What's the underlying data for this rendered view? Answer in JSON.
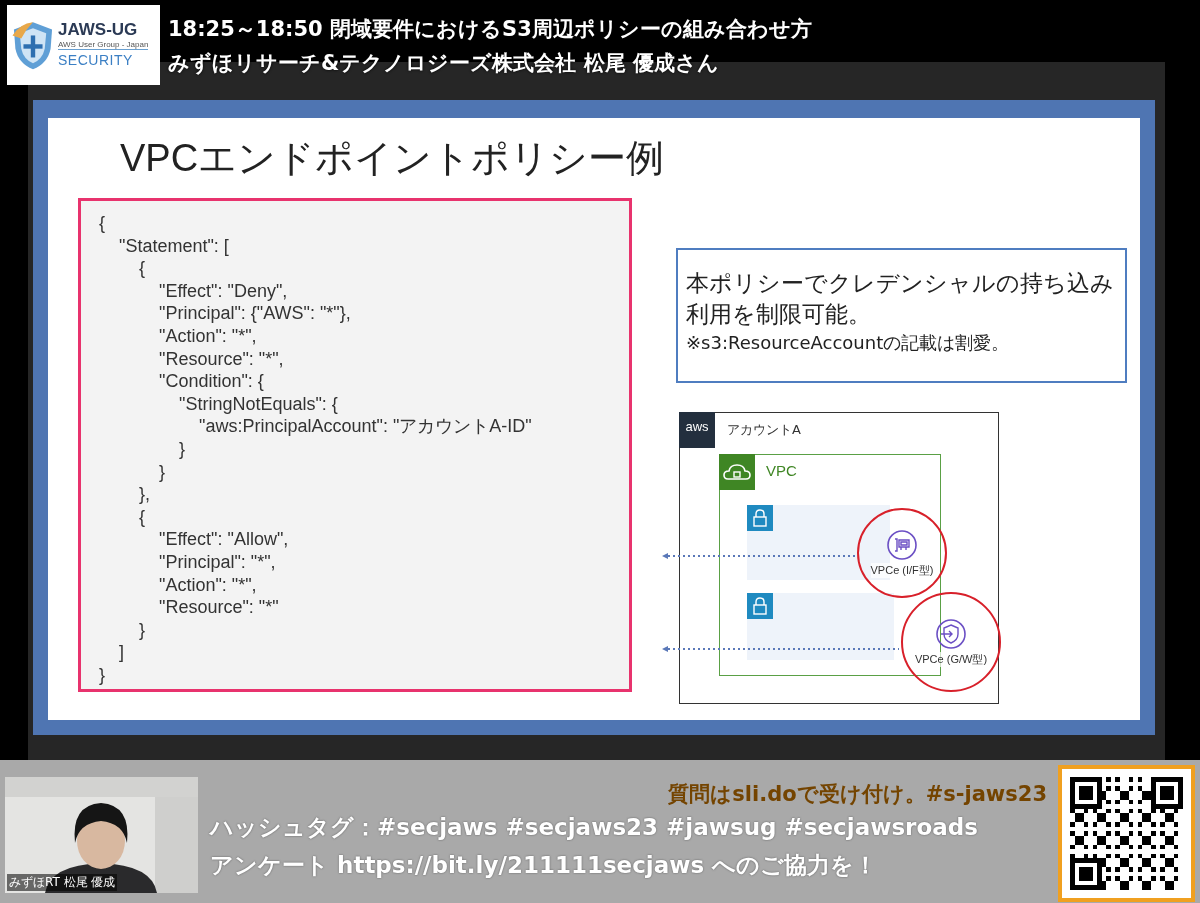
{
  "header": {
    "logo": {
      "title": "JAWS-UG",
      "subtitle": "AWS User Group - Japan",
      "label": "SECURITY"
    },
    "title": "18:25～18:50 閉域要件におけるS3周辺ポリシーの組み合わせ方",
    "speaker": "みずほリサーチ&テクノロジーズ株式会社 松尾 優成さん"
  },
  "slide": {
    "title": "VPCエンドポイントポリシー例",
    "code_lines": [
      "{",
      "    \"Statement\": [",
      "        {",
      "            \"Effect\": \"Deny\",",
      "            \"Principal\": {\"AWS\": \"*\"},",
      "            \"Action\": \"*\",",
      "            \"Resource\": \"*\",",
      "            \"Condition\": {",
      "                \"StringNotEquals\": {",
      "                    \"aws:PrincipalAccount\": \"アカウントA-ID\"",
      "                }",
      "            }",
      "        },",
      "        {",
      "            \"Effect\": \"Allow\",",
      "            \"Principal\": \"*\",",
      "            \"Action\": \"*\",",
      "            \"Resource\": \"*\"",
      "        }",
      "    ]",
      "}"
    ],
    "callout": {
      "lines": [
        "本ポリシーでクレデンシャルの持ち込み",
        "利用を制限可能。"
      ],
      "note": "※s3:ResourceAccountの記載は割愛。"
    },
    "diagram": {
      "badge": "aws",
      "account": "アカウントA",
      "vpc": "VPC",
      "endpoints": [
        {
          "label": "VPCe (I/F型)",
          "kind": "interface"
        },
        {
          "label": "VPCe (G/W型)",
          "kind": "gateway"
        }
      ]
    }
  },
  "webcam": {
    "caption": "みずほRT 松尾 優成"
  },
  "footer": {
    "notice": "質問はsli.doで受け付け。#s-jaws23",
    "lines": [
      "ハッシュタグ：#secjaws #secjaws23 #jawsug #secjawsroads",
      "アンケート https://bit.ly/211111secjaws へのご協力を！"
    ]
  }
}
